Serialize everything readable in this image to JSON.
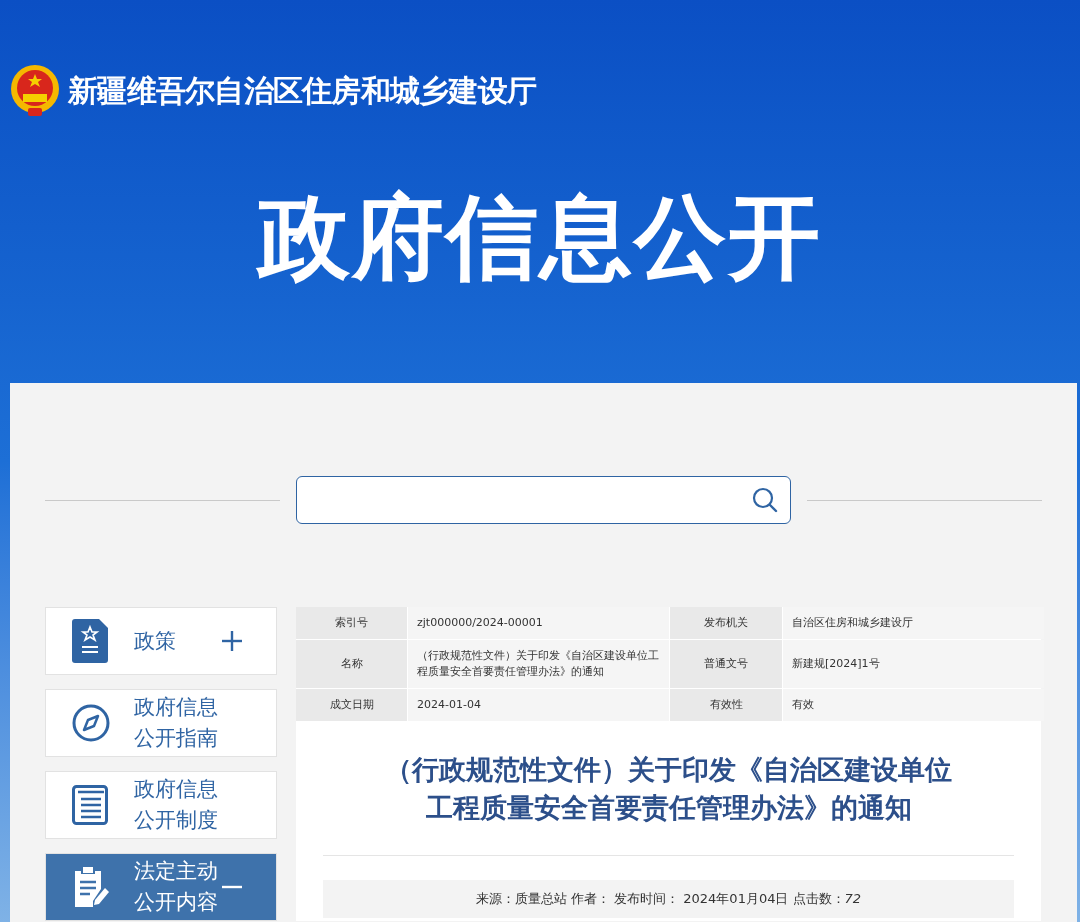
{
  "header": {
    "site_name": "新疆维吾尔自治区住房和城乡建设厅",
    "banner_title": "政府信息公开"
  },
  "sidebar": {
    "items": [
      {
        "kind": "policy",
        "label": "政策",
        "selected": false,
        "expanded": false
      },
      {
        "kind": "guide",
        "label": "政府信息公开指南",
        "selected": false
      },
      {
        "kind": "system",
        "label": "政府信息公开制度",
        "selected": false
      },
      {
        "kind": "content",
        "label": "法定主动公开内容",
        "selected": true,
        "expanded": true
      }
    ]
  },
  "info_table": {
    "rows": [
      [
        {
          "label": "索引号",
          "value": "zjt000000/2024-00001"
        },
        {
          "label": "发布机关",
          "value": "自治区住房和城乡建设厅"
        }
      ],
      [
        {
          "label": "名称",
          "value": "（行政规范性文件）关于印发《自治区建设单位工程质量安全首要责任管理办法》的通知"
        },
        {
          "label": "普通文号",
          "value": "新建规[2024]1号"
        }
      ],
      [
        {
          "label": "成文日期",
          "value": "2024-01-04"
        },
        {
          "label": "有效性",
          "value": "有效"
        }
      ]
    ]
  },
  "article": {
    "title": "（行政规范性文件）关于印发《自治区建设单位工程质量安全首要责任管理办法》的通知",
    "meta": "来源：质量总站 作者： 发布时间： 2024年01月04日 点击数：*72*"
  }
}
